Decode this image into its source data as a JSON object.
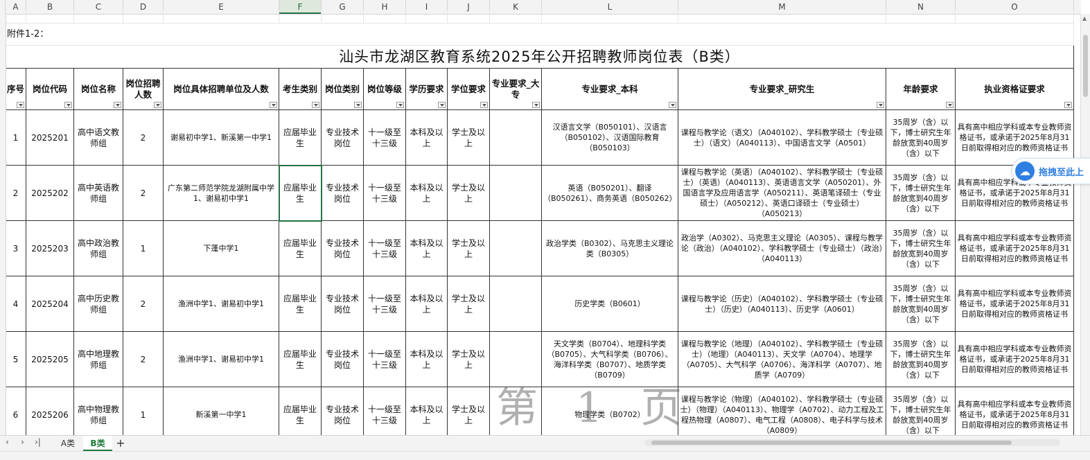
{
  "columns": [
    "A",
    "B",
    "C",
    "D",
    "E",
    "F",
    "G",
    "H",
    "I",
    "J",
    "K",
    "L",
    "M",
    "N",
    "O"
  ],
  "note": "附件1-2：",
  "title": "汕头市龙湖区教育系统2025年公开招聘教师岗位表（B类）",
  "headers": {
    "seq": "序号",
    "code": "岗位代码",
    "name": "岗位名称",
    "count": "岗位招聘人数",
    "unit": "岗位具体招聘单位及人数",
    "candidate": "考生类别",
    "postType": "岗位类别",
    "level": "岗位等级",
    "edu": "学历要求",
    "degree": "学位要求",
    "majorDz": "专业要求_大专",
    "majorBk": "专业要求_本科",
    "majorYjs": "专业要求_研究生",
    "age": "年龄要求",
    "cert": "执业资格证要求"
  },
  "rows": [
    {
      "seq": "1",
      "code": "2025201",
      "name": "高中语文教师组",
      "count": "2",
      "unit": "谢易初中学1、新溪第一中学1",
      "candidate": "应届毕业生",
      "postType": "专业技术岗位",
      "level": "十一级至十三级",
      "edu": "本科及以上",
      "degree": "学士及以上",
      "majorDz": "",
      "majorBk": "汉语言文学（B050101）、汉语言（B050102）、汉语国际教育（B050103）",
      "majorYjs": "课程与教学论（语文）（A040102）、学科教学硕士（专业硕士）（语文）（A040113）、中国语言文学（A0501）",
      "age": "35周岁（含）以下，博士研究生年龄放宽到40周岁（含）以下",
      "cert": "具有高中相应学科或本专业教师资格证书，或承诺于2025年8月31日前取得相对应的教师资格证书"
    },
    {
      "seq": "2",
      "code": "2025202",
      "name": "高中英语教师组",
      "count": "2",
      "unit": "广东第二师范学院龙湖附属中学1、谢易初中学1",
      "candidate": "应届毕业生",
      "postType": "专业技术岗位",
      "level": "十一级至十三级",
      "edu": "本科及以上",
      "degree": "学士及以上",
      "majorDz": "",
      "majorBk": "英语（B050201）、翻译（B050261）、商务英语（B050262）",
      "majorYjs": "课程与教学论（英语）（A040102）、学科教学硕士（专业硕士）（英语）（A040113）、英语语言文学（A050201）、外国语言学及应用语言学（A050211）、英语笔译硕士（专业硕士）（A050212）、英语口译硕士（专业硕士）（A050213）",
      "age": "35周岁（含）以下，博士研究生年龄放宽到40周岁（含）以下",
      "cert": "具有高中相应学科或本专业教师资格证书，或承诺于2025年8月31日前取得相对应的教师资格证书"
    },
    {
      "seq": "3",
      "code": "2025203",
      "name": "高中政治教师组",
      "count": "1",
      "unit": "下蓬中学1",
      "candidate": "应届毕业生",
      "postType": "专业技术岗位",
      "level": "十一级至十三级",
      "edu": "本科及以上",
      "degree": "学士及以上",
      "majorDz": "",
      "majorBk": "政治学类（B0302）、马克思主义理论类（B0305）",
      "majorYjs": "政治学（A0302）、马克思主义理论（A0305）、课程与教学论（政治）（A040102）、学科教学硕士（专业硕士）（政治）（A040113）",
      "age": "35周岁（含）以下，博士研究生年龄放宽到40周岁（含）以下",
      "cert": "具有高中相应学科或本专业教师资格证书，或承诺于2025年8月31日前取得相对应的教师资格证书"
    },
    {
      "seq": "4",
      "code": "2025204",
      "name": "高中历史教师组",
      "count": "2",
      "unit": "渔洲中学1、谢易初中学1",
      "candidate": "应届毕业生",
      "postType": "专业技术岗位",
      "level": "十一级至十三级",
      "edu": "本科及以上",
      "degree": "学士及以上",
      "majorDz": "",
      "majorBk": "历史学类（B0601）",
      "majorYjs": "课程与教学论（历史）（A040102）、学科教学硕士（专业硕士）（历史）（A040113）、历史学（A0601）",
      "age": "35周岁（含）以下，博士研究生年龄放宽到40周岁（含）以下",
      "cert": "具有高中相应学科或本专业教师资格证书，或承诺于2025年8月31日前取得相对应的教师资格证书"
    },
    {
      "seq": "5",
      "code": "2025205",
      "name": "高中地理教师组",
      "count": "2",
      "unit": "渔洲中学1、谢易初中学1",
      "candidate": "应届毕业生",
      "postType": "专业技术岗位",
      "level": "十一级至十三级",
      "edu": "本科及以上",
      "degree": "学士及以上",
      "majorDz": "",
      "majorBk": "天文学类（B0704）、地理科学类（B0705）、大气科学类（B0706）、海洋科学类（B0707）、地质学类（B0709）",
      "majorYjs": "课程与教学论（地理）（A040102）、学科教学硕士（专业硕士）（地理）（A040113）、天文学（A0704）、地理学（A0705）、大气科学（A0706）、海洋科学（A0707）、地质学（A0709）",
      "age": "35周岁（含）以下，博士研究生年龄放宽到40周岁（含）以下",
      "cert": "具有高中相应学科或本专业教师资格证书，或承诺于2025年8月31日前取得相对应的教师资格证书"
    },
    {
      "seq": "6",
      "code": "2025206",
      "name": "高中物理教师组",
      "count": "1",
      "unit": "新溪第一中学1",
      "candidate": "应届毕业生",
      "postType": "专业技术岗位",
      "level": "十一级至十三级",
      "edu": "本科及以上",
      "degree": "学士及以上",
      "majorDz": "",
      "majorBk": "物理学类（B0702）",
      "majorYjs": "课程与教学论（物理）（A040102）、学科教学硕士（专业硕士）（物理）（A040113）、物理学（A0702）、动力工程及工程热物理（A0807）、电气工程（A0808）、电子科学与技术（A0809）",
      "age": "35周岁（含）以下，博士研究生年龄放宽到40周岁（含）以下",
      "cert": "具有高中相应学科或本专业教师资格证书，或承诺于2025年8月31日前取得相对应的教师资格证书"
    }
  ],
  "watermark": "第 1 页",
  "floatButton": "拖拽至此上",
  "tabs": [
    "A类",
    "B类"
  ],
  "tabAdd": "+",
  "accent": "#217346"
}
